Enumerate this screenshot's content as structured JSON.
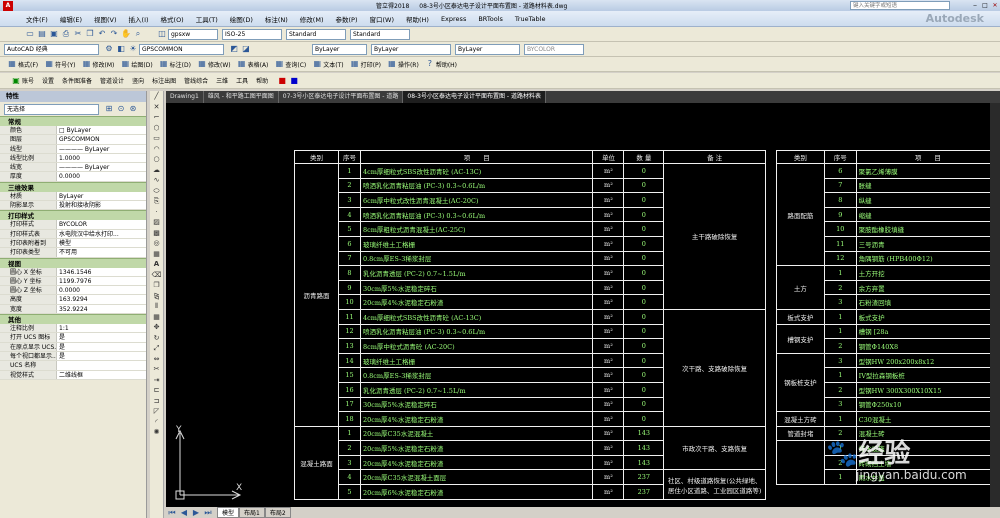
{
  "title": {
    "app": "管立得2018",
    "file": "08-3号小区泰达电子设计平面布置图 - 道路材料表.dwg",
    "search_placeholder": "键入关键字或短语"
  },
  "menu": [
    "文件(F)",
    "编辑(E)",
    "视图(V)",
    "插入(I)",
    "格式(O)",
    "工具(T)",
    "绘图(D)",
    "标注(N)",
    "修改(M)",
    "参数(P)",
    "窗口(W)",
    "帮助(H)",
    "Express",
    "BRTools",
    "TrueTable"
  ],
  "toolbar1": {
    "workspace": "AutoCAD 经典",
    "layer": "GPSCOMMON",
    "textstyle": "gpsxw",
    "dimstyle": "ISO-25",
    "tablestyle": "Standard",
    "mlstyle": "Standard"
  },
  "toolbar2": {
    "color": "ByLayer",
    "linetype": "ByLayer",
    "lineweight": "ByLayer",
    "plotstyle": "BYCOLOR"
  },
  "toolbar3": [
    "格式(F)",
    "符号(Y)",
    "修改(M)",
    "绘图(D)",
    "标注(D)",
    "修改(W)",
    "表格(A)",
    "查询(C)",
    "文本(T)",
    "打印(P)",
    "操作(R)",
    "帮助(H)"
  ],
  "toolbar4": [
    "账号",
    "设置",
    "条件图准备",
    "管道设计",
    "竖向",
    "标注出图",
    "管线综合",
    "三维",
    "工具",
    "帮助"
  ],
  "properties": {
    "title": "特性",
    "selection": "无选择",
    "sections": [
      {
        "header": "常规",
        "rows": [
          [
            "颜色",
            "□ ByLayer"
          ],
          [
            "图层",
            "GPSCOMMON"
          ],
          [
            "线型",
            "———— ByLayer"
          ],
          [
            "线型比例",
            "1.0000"
          ],
          [
            "线宽",
            "———— ByLayer"
          ],
          [
            "厚度",
            "0.0000"
          ]
        ]
      },
      {
        "header": "三维效果",
        "rows": [
          [
            "材质",
            "ByLayer"
          ],
          [
            "阴影显示",
            "投射和接收阴影"
          ]
        ]
      },
      {
        "header": "打印样式",
        "rows": [
          [
            "打印样式",
            "BYCOLOR"
          ],
          [
            "打印样式表",
            "水电院汉中给水打印..."
          ],
          [
            "打印表附着到",
            "模型"
          ],
          [
            "打印表类型",
            "不可用"
          ]
        ]
      },
      {
        "header": "视图",
        "rows": [
          [
            "圆心 X 坐标",
            "1346.1546"
          ],
          [
            "圆心 Y 坐标",
            "1199.7976"
          ],
          [
            "圆心 Z 坐标",
            "0.0000"
          ],
          [
            "高度",
            "163.9294"
          ],
          [
            "宽度",
            "352.9224"
          ]
        ]
      },
      {
        "header": "其他",
        "rows": [
          [
            "注释比例",
            "1:1"
          ],
          [
            "打开 UCS 图标",
            "是"
          ],
          [
            "在原点显示 UCS...",
            "是"
          ],
          [
            "每个视口都显示...",
            "是"
          ],
          [
            "UCS 名称",
            ""
          ],
          [
            "视觉样式",
            "二维线框"
          ]
        ]
      }
    ]
  },
  "drawing_tabs": [
    "Drawing1",
    "雄风 - 和平路工图平面图",
    "07-3号小区泰达电子设计平面布置图 - 道路",
    "08-3号小区泰达电子设计平面布置图 - 道路材料表"
  ],
  "layout_tabs": [
    "模型",
    "布局1",
    "布局2"
  ],
  "table_left": {
    "headers": [
      "类别",
      "序号",
      "项　　目",
      "单位",
      "数 量",
      "备 注"
    ],
    "groups": [
      {
        "category": "沥青路面",
        "rows": [
          [
            "1",
            "4cm厚细粒式SBS改性沥青砼 (AC-13C)",
            "m²",
            "0"
          ],
          [
            "2",
            "喷洒乳化沥青粘层油 (PC-3) 0.3~0.6L/m",
            "m²",
            "0"
          ],
          [
            "3",
            "6cm厚中粒式改性沥青混凝土(AC-20C)",
            "m²",
            "0"
          ],
          [
            "4",
            "喷洒乳化沥青粘层油 (PC-3) 0.3~0.6L/m",
            "m²",
            "0"
          ],
          [
            "5",
            "8cm厚粗粒式沥青混凝土(AC-25C)",
            "m²",
            "0"
          ],
          [
            "6",
            "玻璃纤维土工格栅",
            "m²",
            "0"
          ],
          [
            "7",
            "0.8cm厚ES-3稀浆封层",
            "m²",
            "0"
          ],
          [
            "8",
            "乳化沥青透层 (PC-2) 0.7~1.5L/m",
            "m²",
            "0"
          ],
          [
            "9",
            "30cm厚5%水泥稳定碎石",
            "m²",
            "0"
          ],
          [
            "10",
            "20cm厚4%水泥稳定石粉渣",
            "m²",
            "0"
          ],
          [
            "11",
            "4cm厚细粒式SBS改性沥青砼 (AC-13C)",
            "m²",
            "0"
          ],
          [
            "12",
            "喷洒乳化沥青粘层油 (PC-3) 0.3~0.6L/m",
            "m²",
            "0"
          ],
          [
            "13",
            "8cm厚中粒式沥青砼 (AC-20C)",
            "m²",
            "0"
          ],
          [
            "14",
            "玻璃纤维土工格栅",
            "m²",
            "0"
          ],
          [
            "15",
            "0.8cm厚ES-3稀浆封层",
            "m²",
            "0"
          ],
          [
            "16",
            "乳化沥青透层 (PC-2) 0.7~1.5L/m",
            "m²",
            "0"
          ],
          [
            "17",
            "30cm厚5%水泥稳定碎石",
            "m²",
            "0"
          ],
          [
            "18",
            "20cm厚4%水泥稳定石粉渣",
            "m²",
            "0"
          ]
        ]
      },
      {
        "category": "混凝土路面",
        "rows": [
          [
            "1",
            "20cm厚C35水泥混凝土",
            "m²",
            "143"
          ],
          [
            "2",
            "20cm厚5%水泥稳定石粉渣",
            "m²",
            "143"
          ],
          [
            "3",
            "20cm厚4%水泥稳定石粉渣",
            "m²",
            "143"
          ],
          [
            "4",
            "20cm厚C35水泥混凝土面层",
            "m²",
            "237"
          ],
          [
            "5",
            "20cm厚6%水泥稳定石粉渣",
            "m²",
            "237"
          ]
        ]
      }
    ],
    "remarks": [
      "主干路破除恢复",
      "次干路、支路破除恢复",
      "市政次干路、支路恢复",
      "社区、村级道路恢复(公共绿地、居住小区道路、工业园区道路等)"
    ]
  },
  "table_right": {
    "headers": [
      "类别",
      "序号",
      "项　　目"
    ],
    "groups": [
      {
        "category": "路面配筋",
        "rows": [
          [
            "6",
            "聚氯乙烯薄膜"
          ],
          [
            "7",
            "胀缝"
          ],
          [
            "8",
            "纵缝"
          ],
          [
            "9",
            "缩缝"
          ],
          [
            "10",
            "聚胺酯橡胶填缝"
          ],
          [
            "11",
            "三号沥青"
          ],
          [
            "12",
            "角隅钢筋 (HPB400Φ12)"
          ]
        ]
      },
      {
        "category": "土方",
        "rows": [
          [
            "1",
            "土方开挖"
          ],
          [
            "2",
            "余方弃置"
          ],
          [
            "3",
            "石粉渣回填"
          ]
        ]
      },
      {
        "category": "板式支护",
        "rows": [
          [
            "1",
            "板式支护"
          ]
        ]
      },
      {
        "category": "槽钢支护",
        "rows": [
          [
            "1",
            "槽钢 [28a"
          ],
          [
            "2",
            "钢管Φ140X8"
          ]
        ]
      },
      {
        "category": "钢板桩支护",
        "rows": [
          [
            "3",
            "型钢HW 200x200x8x12"
          ],
          [
            "1",
            "IV型拉森钢板桩"
          ],
          [
            "2",
            "型钢HW 300X300X10X15"
          ],
          [
            "3",
            "钢管Φ250x10"
          ]
        ]
      },
      {
        "category": "混凝土方砖",
        "rows": [
          [
            "1",
            "C30混凝土"
          ]
        ]
      },
      {
        "category": "管道封堵",
        "rows": [
          [
            "2",
            "混凝土砖"
          ]
        ]
      },
      {
        "category": "",
        "rows": [
          [
            "1",
            "排水设施"
          ],
          [
            "2",
            "砖砌挡土墙"
          ],
          [
            "1",
            "雨水井盖"
          ]
        ]
      }
    ]
  },
  "ucs": {
    "x": "X",
    "y": "Y"
  },
  "watermark": {
    "text": "经验",
    "sub": "jingyan.baidu.com"
  }
}
